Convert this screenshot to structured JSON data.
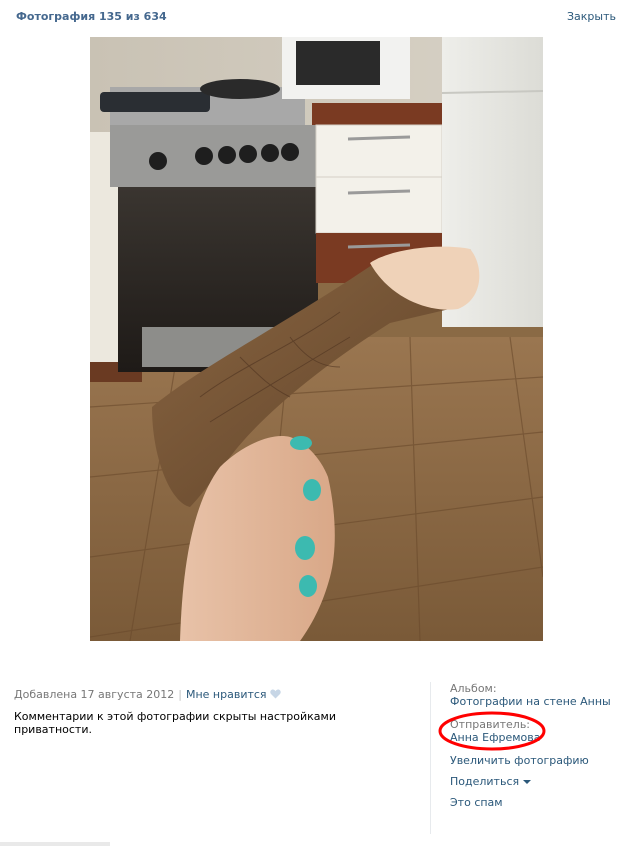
{
  "header": {
    "title": "Фотография 135 из 634",
    "close_label": "Закрыть"
  },
  "photo": {
    "alt": ""
  },
  "info": {
    "added": "Добавлена 17 августа 2012",
    "separator": "|",
    "like_label": "Мне нравится",
    "privacy_note": "Комментарии к этой фотографии скрыты настройками приватности."
  },
  "sidebar": {
    "album_label": "Альбом:",
    "album_name": "Фотографии на стене Анны",
    "sender_label": "Отправитель:",
    "sender_name": "Анна Ефремова",
    "actions": {
      "enlarge": "Увеличить фотографию",
      "share": "Поделиться",
      "spam": "Это спам"
    }
  },
  "colors": {
    "link": "#2b587a",
    "title": "#45688e",
    "muted": "#777777",
    "highlight_ring": "#ff0000"
  },
  "icons": {
    "like": "heart-icon",
    "share_dropdown": "chevron-down-icon"
  }
}
